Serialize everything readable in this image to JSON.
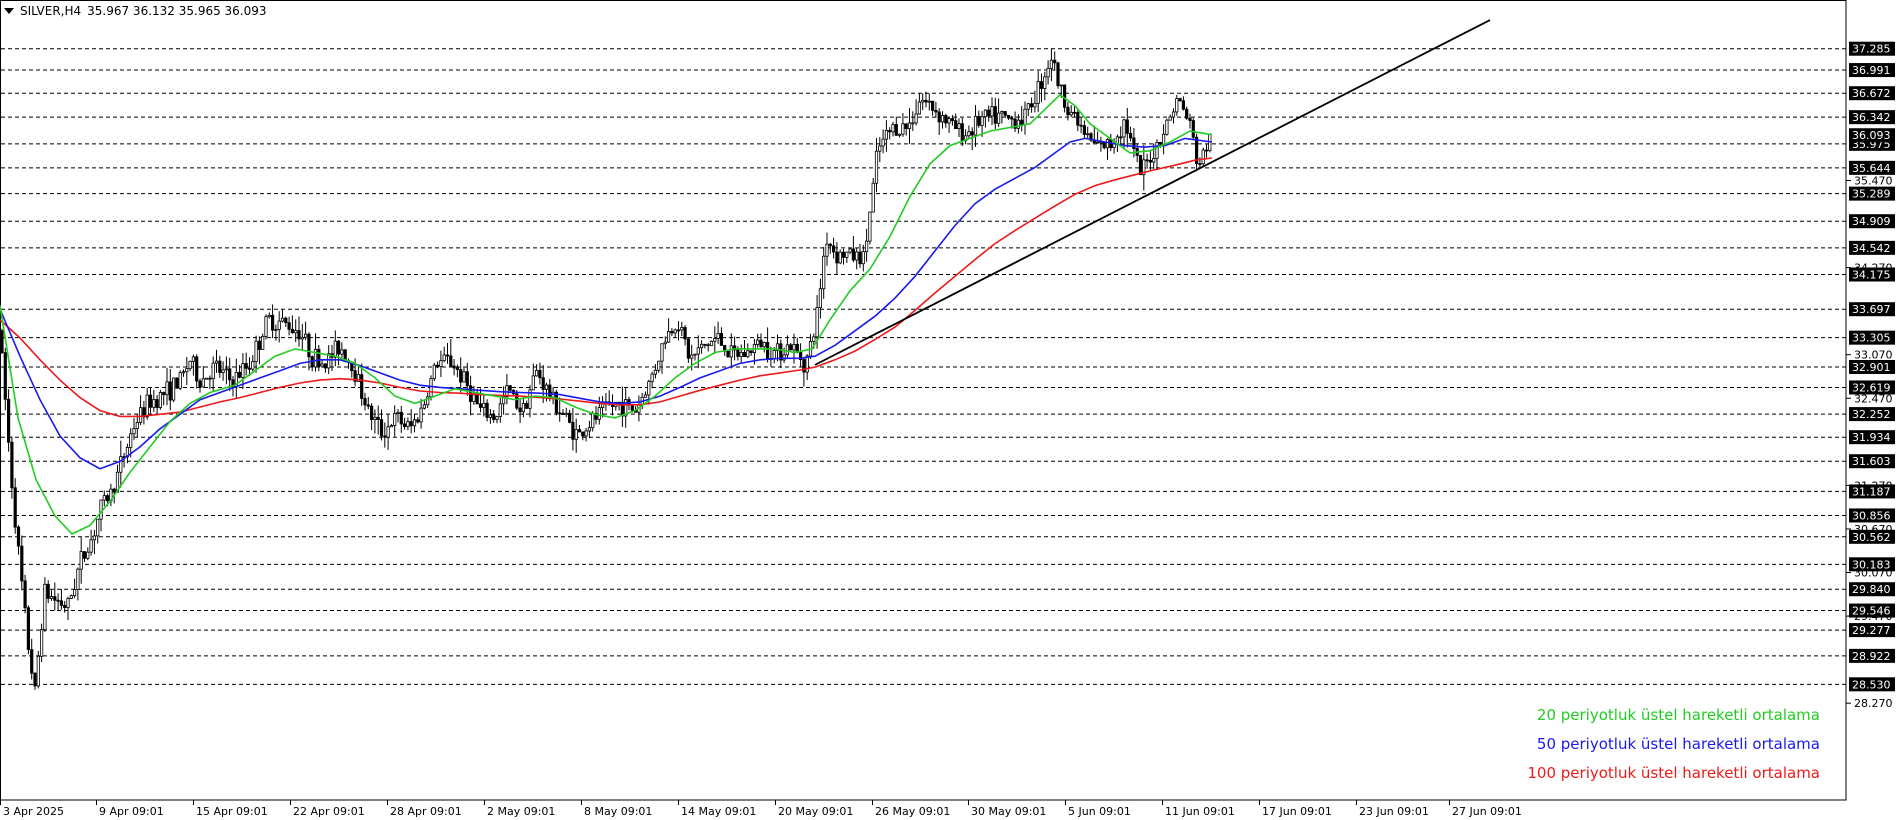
{
  "header": {
    "symbol_tf": "SILVER,H4",
    "ohlc": "35.967 36.132 35.965 36.093"
  },
  "legend": [
    {
      "text": "20 periyotluk üstel hareketli ortalama",
      "color": "#22cc22"
    },
    {
      "text": "50 periyotluk üstel hareketli ortalama",
      "color": "#1a1aee"
    },
    {
      "text": "100 periyotluk üstel hareketli ortalama",
      "color": "#ee1a1a"
    }
  ],
  "chart_data": {
    "type": "candlestick",
    "ylim": [
      28.12,
      37.62
    ],
    "grid": "horizontal-dashed",
    "x_ticks": [
      "3 Apr 2025",
      "9 Apr 09:01",
      "15 Apr 09:01",
      "22 Apr 09:01",
      "28 Apr 09:01",
      "2 May 09:01",
      "8 May 09:01",
      "14 May 09:01",
      "20 May 09:01",
      "26 May 09:01",
      "30 May 09:01",
      "5 Jun 09:01",
      "11 Jun 09:01",
      "17 Jun 09:01",
      "23 Jun 09:01",
      "27 Jun 09:01"
    ],
    "y_ticks_plain": [
      "35.470",
      "34.270",
      "33.070",
      "32.470",
      "31.270",
      "30.670",
      "30.070",
      "29.470",
      "28.270"
    ],
    "levels_boxed": [
      "37.285",
      "36.991",
      "36.672",
      "36.342",
      "35.975",
      "35.644",
      "35.289",
      "34.909",
      "34.542",
      "34.175",
      "33.697",
      "33.305",
      "32.901",
      "32.619",
      "32.252",
      "31.934",
      "31.603",
      "31.187",
      "30.856",
      "30.562",
      "30.183",
      "29.840",
      "29.546",
      "29.277",
      "28.922",
      "28.530"
    ],
    "current_price": "36.093",
    "price_path": [
      [
        0,
        33.4
      ],
      [
        10,
        31.6
      ],
      [
        18,
        30.4
      ],
      [
        27,
        29.2
      ],
      [
        35,
        28.4
      ],
      [
        44,
        29.8
      ],
      [
        55,
        29.7
      ],
      [
        68,
        29.6
      ],
      [
        80,
        30.2
      ],
      [
        92,
        30.55
      ],
      [
        102,
        31.0
      ],
      [
        112,
        31.2
      ],
      [
        122,
        31.6
      ],
      [
        134,
        32.1
      ],
      [
        148,
        32.4
      ],
      [
        165,
        32.55
      ],
      [
        180,
        32.7
      ],
      [
        190,
        33.0
      ],
      [
        200,
        32.7
      ],
      [
        215,
        32.9
      ],
      [
        232,
        32.7
      ],
      [
        250,
        32.95
      ],
      [
        268,
        33.55
      ],
      [
        285,
        33.5
      ],
      [
        300,
        33.4
      ],
      [
        312,
        33.05
      ],
      [
        325,
        32.95
      ],
      [
        340,
        33.2
      ],
      [
        355,
        32.85
      ],
      [
        368,
        32.3
      ],
      [
        382,
        32.0
      ],
      [
        396,
        32.2
      ],
      [
        410,
        32.05
      ],
      [
        423,
        32.35
      ],
      [
        436,
        32.95
      ],
      [
        450,
        33.0
      ],
      [
        465,
        32.7
      ],
      [
        480,
        32.3
      ],
      [
        495,
        32.2
      ],
      [
        508,
        32.6
      ],
      [
        522,
        32.3
      ],
      [
        537,
        32.85
      ],
      [
        550,
        32.5
      ],
      [
        563,
        32.25
      ],
      [
        578,
        31.95
      ],
      [
        592,
        32.15
      ],
      [
        607,
        32.35
      ],
      [
        620,
        32.4
      ],
      [
        635,
        32.3
      ],
      [
        650,
        32.7
      ],
      [
        665,
        33.3
      ],
      [
        678,
        33.55
      ],
      [
        690,
        33.0
      ],
      [
        705,
        33.2
      ],
      [
        718,
        33.3
      ],
      [
        732,
        33.05
      ],
      [
        748,
        33.1
      ],
      [
        760,
        33.25
      ],
      [
        775,
        33.1
      ],
      [
        790,
        33.2
      ],
      [
        806,
        32.95
      ],
      [
        816,
        33.5
      ],
      [
        826,
        34.7
      ],
      [
        836,
        34.45
      ],
      [
        848,
        34.45
      ],
      [
        864,
        34.4
      ],
      [
        878,
        35.9
      ],
      [
        893,
        36.2
      ],
      [
        908,
        36.2
      ],
      [
        920,
        36.6
      ],
      [
        935,
        36.45
      ],
      [
        950,
        36.25
      ],
      [
        965,
        36.1
      ],
      [
        980,
        36.3
      ],
      [
        995,
        36.35
      ],
      [
        1010,
        36.3
      ],
      [
        1025,
        36.35
      ],
      [
        1040,
        36.8
      ],
      [
        1052,
        37.2
      ],
      [
        1060,
        36.7
      ],
      [
        1072,
        36.4
      ],
      [
        1085,
        36.1
      ],
      [
        1095,
        35.95
      ],
      [
        1110,
        35.95
      ],
      [
        1125,
        36.3
      ],
      [
        1140,
        35.55
      ],
      [
        1155,
        35.9
      ],
      [
        1165,
        36.2
      ],
      [
        1178,
        36.6
      ],
      [
        1190,
        36.25
      ],
      [
        1198,
        35.65
      ],
      [
        1205,
        35.9
      ],
      [
        1212,
        36.09
      ]
    ],
    "ema20": [
      [
        0,
        33.75
      ],
      [
        18,
        32.2
      ],
      [
        36,
        31.35
      ],
      [
        55,
        30.85
      ],
      [
        72,
        30.6
      ],
      [
        90,
        30.72
      ],
      [
        110,
        31.05
      ],
      [
        130,
        31.45
      ],
      [
        150,
        31.8
      ],
      [
        170,
        32.15
      ],
      [
        190,
        32.4
      ],
      [
        210,
        32.55
      ],
      [
        235,
        32.65
      ],
      [
        255,
        32.85
      ],
      [
        275,
        33.05
      ],
      [
        295,
        33.15
      ],
      [
        315,
        33.1
      ],
      [
        335,
        33.05
      ],
      [
        355,
        32.95
      ],
      [
        375,
        32.75
      ],
      [
        395,
        32.5
      ],
      [
        415,
        32.4
      ],
      [
        435,
        32.5
      ],
      [
        455,
        32.6
      ],
      [
        475,
        32.55
      ],
      [
        495,
        32.5
      ],
      [
        515,
        32.45
      ],
      [
        535,
        32.5
      ],
      [
        555,
        32.48
      ],
      [
        575,
        32.35
      ],
      [
        595,
        32.25
      ],
      [
        615,
        32.2
      ],
      [
        635,
        32.3
      ],
      [
        655,
        32.5
      ],
      [
        675,
        32.75
      ],
      [
        695,
        32.95
      ],
      [
        715,
        33.1
      ],
      [
        735,
        33.15
      ],
      [
        755,
        33.15
      ],
      [
        775,
        33.15
      ],
      [
        795,
        33.1
      ],
      [
        812,
        33.15
      ],
      [
        830,
        33.55
      ],
      [
        850,
        33.95
      ],
      [
        870,
        34.25
      ],
      [
        890,
        34.7
      ],
      [
        910,
        35.25
      ],
      [
        930,
        35.7
      ],
      [
        950,
        35.95
      ],
      [
        970,
        36.05
      ],
      [
        990,
        36.15
      ],
      [
        1010,
        36.2
      ],
      [
        1030,
        36.25
      ],
      [
        1045,
        36.45
      ],
      [
        1060,
        36.65
      ],
      [
        1075,
        36.5
      ],
      [
        1090,
        36.25
      ],
      [
        1110,
        36.05
      ],
      [
        1130,
        35.85
      ],
      [
        1150,
        35.88
      ],
      [
        1170,
        36.0
      ],
      [
        1190,
        36.15
      ],
      [
        1212,
        36.1
      ]
    ],
    "ema50": [
      [
        0,
        33.7
      ],
      [
        20,
        33.05
      ],
      [
        40,
        32.45
      ],
      [
        60,
        31.95
      ],
      [
        80,
        31.65
      ],
      [
        100,
        31.5
      ],
      [
        120,
        31.6
      ],
      [
        140,
        31.8
      ],
      [
        160,
        32.05
      ],
      [
        180,
        32.25
      ],
      [
        200,
        32.45
      ],
      [
        220,
        32.55
      ],
      [
        240,
        32.65
      ],
      [
        260,
        32.75
      ],
      [
        280,
        32.85
      ],
      [
        300,
        32.95
      ],
      [
        320,
        33.0
      ],
      [
        340,
        33.0
      ],
      [
        360,
        32.92
      ],
      [
        380,
        32.82
      ],
      [
        400,
        32.72
      ],
      [
        420,
        32.65
      ],
      [
        440,
        32.62
      ],
      [
        460,
        32.6
      ],
      [
        480,
        32.58
      ],
      [
        500,
        32.56
      ],
      [
        520,
        32.55
      ],
      [
        540,
        32.54
      ],
      [
        560,
        32.52
      ],
      [
        580,
        32.47
      ],
      [
        600,
        32.42
      ],
      [
        620,
        32.4
      ],
      [
        640,
        32.42
      ],
      [
        660,
        32.5
      ],
      [
        680,
        32.62
      ],
      [
        700,
        32.75
      ],
      [
        720,
        32.85
      ],
      [
        740,
        32.95
      ],
      [
        760,
        33.0
      ],
      [
        780,
        33.02
      ],
      [
        800,
        33.02
      ],
      [
        815,
        33.05
      ],
      [
        835,
        33.2
      ],
      [
        855,
        33.4
      ],
      [
        875,
        33.6
      ],
      [
        895,
        33.85
      ],
      [
        915,
        34.15
      ],
      [
        935,
        34.5
      ],
      [
        955,
        34.85
      ],
      [
        975,
        35.15
      ],
      [
        995,
        35.35
      ],
      [
        1015,
        35.5
      ],
      [
        1035,
        35.65
      ],
      [
        1055,
        35.85
      ],
      [
        1070,
        36.0
      ],
      [
        1085,
        36.05
      ],
      [
        1105,
        36.0
      ],
      [
        1125,
        35.95
      ],
      [
        1145,
        35.93
      ],
      [
        1165,
        35.95
      ],
      [
        1185,
        36.05
      ],
      [
        1212,
        36.0
      ]
    ],
    "ema100": [
      [
        0,
        33.55
      ],
      [
        20,
        33.3
      ],
      [
        40,
        33.0
      ],
      [
        60,
        32.72
      ],
      [
        80,
        32.48
      ],
      [
        100,
        32.3
      ],
      [
        120,
        32.22
      ],
      [
        140,
        32.22
      ],
      [
        160,
        32.25
      ],
      [
        180,
        32.28
      ],
      [
        200,
        32.35
      ],
      [
        220,
        32.42
      ],
      [
        240,
        32.48
      ],
      [
        260,
        32.55
      ],
      [
        280,
        32.62
      ],
      [
        300,
        32.68
      ],
      [
        320,
        32.72
      ],
      [
        340,
        32.74
      ],
      [
        360,
        32.72
      ],
      [
        380,
        32.68
      ],
      [
        400,
        32.62
      ],
      [
        420,
        32.57
      ],
      [
        440,
        32.55
      ],
      [
        460,
        32.54
      ],
      [
        480,
        32.52
      ],
      [
        500,
        32.51
      ],
      [
        520,
        32.5
      ],
      [
        540,
        32.48
      ],
      [
        560,
        32.46
      ],
      [
        580,
        32.43
      ],
      [
        600,
        32.4
      ],
      [
        620,
        32.38
      ],
      [
        640,
        32.38
      ],
      [
        660,
        32.42
      ],
      [
        680,
        32.5
      ],
      [
        700,
        32.58
      ],
      [
        720,
        32.65
      ],
      [
        740,
        32.72
      ],
      [
        760,
        32.78
      ],
      [
        780,
        32.82
      ],
      [
        800,
        32.86
      ],
      [
        815,
        32.9
      ],
      [
        835,
        33.0
      ],
      [
        855,
        33.12
      ],
      [
        875,
        33.28
      ],
      [
        895,
        33.45
      ],
      [
        915,
        33.68
      ],
      [
        935,
        33.92
      ],
      [
        955,
        34.15
      ],
      [
        975,
        34.38
      ],
      [
        995,
        34.6
      ],
      [
        1015,
        34.78
      ],
      [
        1035,
        34.95
      ],
      [
        1055,
        35.12
      ],
      [
        1075,
        35.28
      ],
      [
        1095,
        35.4
      ],
      [
        1115,
        35.48
      ],
      [
        1135,
        35.55
      ],
      [
        1155,
        35.62
      ],
      [
        1175,
        35.68
      ],
      [
        1195,
        35.75
      ],
      [
        1212,
        35.78
      ]
    ],
    "trendline": [
      [
        815,
        32.93
      ],
      [
        1490,
        37.68
      ]
    ]
  }
}
